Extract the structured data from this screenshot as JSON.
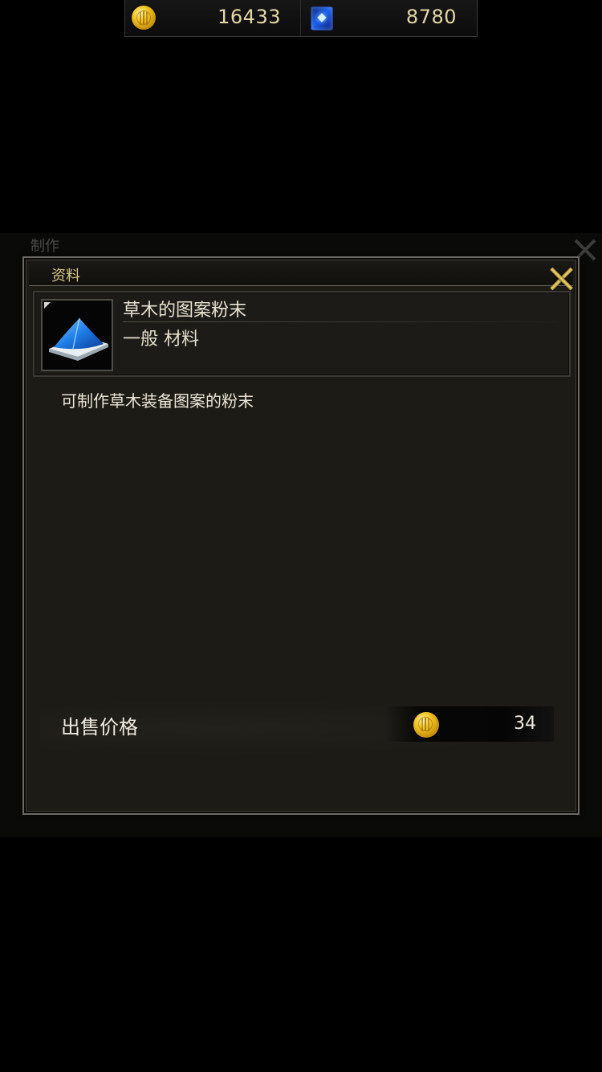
{
  "currency": {
    "gold": "16433",
    "gems": "8780"
  },
  "background_window": {
    "title": "制作"
  },
  "dialog": {
    "title": "资料",
    "item": {
      "name": "草木的图案粉末",
      "type": "一般 材料",
      "icon": "blue-powder-pile-icon"
    },
    "description": "可制作草木装备图案的粉末",
    "price_label": "出售价格",
    "price_value": "34"
  },
  "colors": {
    "title_gold": "#d8c58a",
    "close_gold": "#f6dc7a",
    "panel_bg": "#1d1b16"
  }
}
